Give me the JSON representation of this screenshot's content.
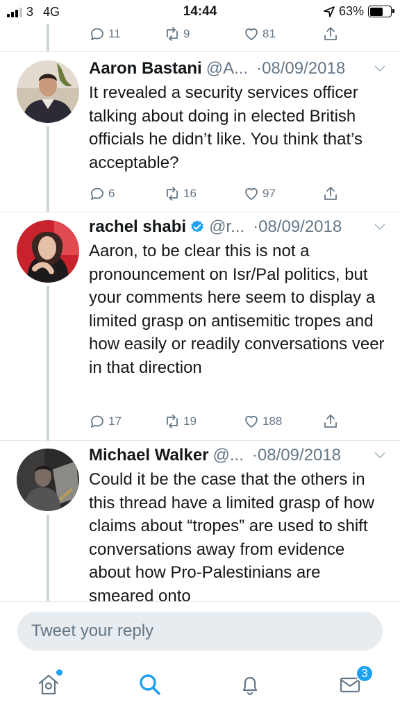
{
  "status_bar": {
    "carrier": "3",
    "network": "4G",
    "time": "14:44",
    "battery_percent": "63%",
    "battery_level": 0.63,
    "signal_bars_active": 3,
    "signal_bars_total": 4
  },
  "top_actions": {
    "replies": "11",
    "retweets": "9",
    "likes": "81"
  },
  "tweets": [
    {
      "name": "Aaron Bastani",
      "handle": "@A...",
      "date": "·08/09/2018",
      "verified": false,
      "text": "It revealed a security services officer talking about doing in elected British officials he didn’t like. You think that’s acceptable?",
      "replies": "6",
      "retweets": "16",
      "likes": "97"
    },
    {
      "name": "rachel shabi",
      "handle": "@r...",
      "date": "·08/09/2018",
      "verified": true,
      "text": "Aaron, to be clear this is not a pronouncement on Isr/Pal politics, but your comments here seem to display a limited grasp on antisemitic tropes and how easily or readily conversations veer in that direction",
      "replies": "17",
      "retweets": "19",
      "likes": "188"
    },
    {
      "name": "Michael Walker",
      "handle": "@...",
      "date": "·08/09/2018",
      "verified": false,
      "text": "Could it be the case that the others in this thread have a limited grasp of how claims about “tropes” are used to shift conversations away from evidence about how Pro-Palestinians are smeared onto"
    }
  ],
  "composer": {
    "placeholder": "Tweet your reply"
  },
  "tab_bar": {
    "items": [
      "home-icon",
      "search-icon",
      "bell-icon",
      "envelope-icon"
    ],
    "messages_badge": "3"
  },
  "colors": {
    "accent": "#1da1f2",
    "secondary_text": "#657786",
    "thread_line": "#ccd6dd",
    "reply_box": "#e6ecf0"
  }
}
